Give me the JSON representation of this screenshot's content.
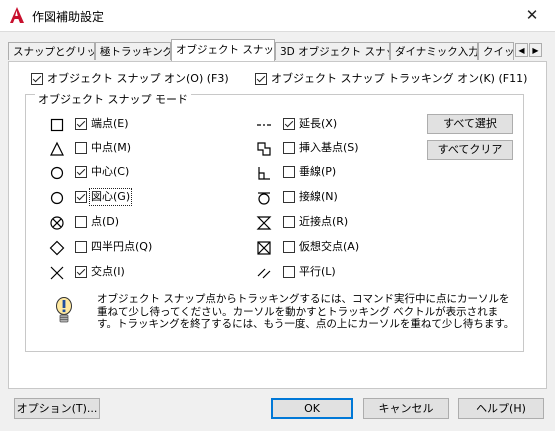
{
  "window": {
    "title": "作図補助設定",
    "close_glyph": "✕"
  },
  "tabs": [
    "スナップとグリッド",
    "極トラッキング",
    "オブジェクト スナップ",
    "3D オブジェクト スナップ",
    "ダイナミック入力",
    "クイッ"
  ],
  "tab_scroll": {
    "left": "◀",
    "right": "▶"
  },
  "top_options": {
    "osnap_on": {
      "label": "オブジェクト スナップ オン(O) (F3)",
      "checked": true
    },
    "osnap_tracking": {
      "label": "オブジェクト スナップ トラッキング オン(K) (F11)",
      "checked": true
    }
  },
  "group_title": "オブジェクト スナップ モード",
  "modes_left": [
    {
      "label": "端点(E)",
      "checked": true,
      "icon": "endpoint-square-icon"
    },
    {
      "label": "中点(M)",
      "checked": false,
      "icon": "midpoint-triangle-icon"
    },
    {
      "label": "中心(C)",
      "checked": true,
      "icon": "center-circle-icon"
    },
    {
      "label": "図心(G)",
      "checked": true,
      "icon": "geometric-center-icon"
    },
    {
      "label": "点(D)",
      "checked": false,
      "icon": "node-icon"
    },
    {
      "label": "四半円点(Q)",
      "checked": false,
      "icon": "quadrant-diamond-icon"
    },
    {
      "label": "交点(I)",
      "checked": true,
      "icon": "intersection-x-icon"
    }
  ],
  "modes_right": [
    {
      "label": "延長(X)",
      "checked": true,
      "icon": "extension-icon"
    },
    {
      "label": "挿入基点(S)",
      "checked": false,
      "icon": "insertion-icon"
    },
    {
      "label": "垂線(P)",
      "checked": false,
      "icon": "perpendicular-icon"
    },
    {
      "label": "接線(N)",
      "checked": false,
      "icon": "tangent-icon"
    },
    {
      "label": "近接点(R)",
      "checked": false,
      "icon": "nearest-hourglass-icon"
    },
    {
      "label": "仮想交点(A)",
      "checked": false,
      "icon": "apparent-intersection-icon"
    },
    {
      "label": "平行(L)",
      "checked": false,
      "icon": "parallel-icon"
    }
  ],
  "side_buttons": {
    "select_all": "すべて選択",
    "clear_all": "すべてクリア"
  },
  "info_text": "オブジェクト スナップ点からトラッキングするには、コマンド実行中に点にカーソルを重ねて少し待ってください。カーソルを動かすとトラッキング ベクトルが表示されます。トラッキングを終了するには、もう一度、点の上にカーソルを重ねて少し待ちます。",
  "footer": {
    "options": "オプション(T)...",
    "ok": "OK",
    "cancel": "キャンセル",
    "help": "ヘルプ(H)"
  }
}
